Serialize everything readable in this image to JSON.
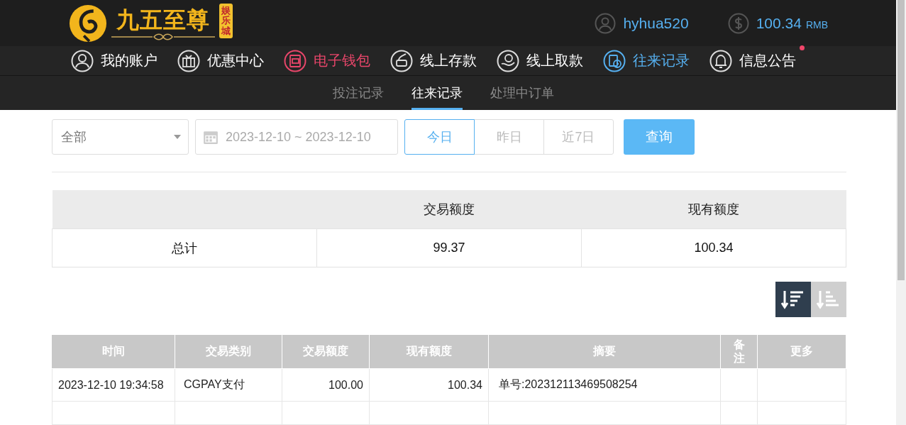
{
  "logo": {
    "name": "九五至尊",
    "badge": "娱乐城"
  },
  "account": {
    "username": "hyhua520",
    "balance": "100.34",
    "currency": "RMB"
  },
  "nav": [
    {
      "label": "我的账户",
      "selected": false,
      "hovered": false,
      "badge": false
    },
    {
      "label": "优惠中心",
      "selected": false,
      "hovered": false,
      "badge": false
    },
    {
      "label": "电子钱包",
      "selected": false,
      "hovered": true,
      "badge": false
    },
    {
      "label": "线上存款",
      "selected": false,
      "hovered": false,
      "badge": false
    },
    {
      "label": "线上取款",
      "selected": false,
      "hovered": false,
      "badge": false
    },
    {
      "label": "往来记录",
      "selected": true,
      "hovered": false,
      "badge": false
    },
    {
      "label": "信息公告",
      "selected": false,
      "hovered": false,
      "badge": true
    }
  ],
  "subtabs": [
    {
      "label": "投注记录",
      "selected": false
    },
    {
      "label": "往来记录",
      "selected": true
    },
    {
      "label": "处理中订单",
      "selected": false
    }
  ],
  "filter": {
    "type": "全部",
    "date_range": "2023-12-10 ~ 2023-12-10",
    "quick": [
      {
        "label": "今日",
        "selected": true
      },
      {
        "label": "昨日",
        "selected": false
      },
      {
        "label": "近7日",
        "selected": false
      }
    ],
    "search_button": "查询"
  },
  "summary": {
    "columns": [
      "交易额度",
      "现有额度"
    ],
    "row": [
      "总计",
      "99.37",
      "100.34"
    ]
  },
  "sort": [
    {
      "kind": "desc",
      "selected": true
    },
    {
      "kind": "asc",
      "selected": false
    }
  ],
  "records": {
    "columns": [
      "时间",
      "交易类别",
      "交易额度",
      "现有额度",
      "摘要",
      "备注",
      "更多"
    ],
    "rows": [
      [
        "2023-12-10 19:34:58",
        "CGPAY支付",
        "100.00",
        "100.34",
        "单号:202312113469508254",
        "",
        ""
      ]
    ]
  }
}
